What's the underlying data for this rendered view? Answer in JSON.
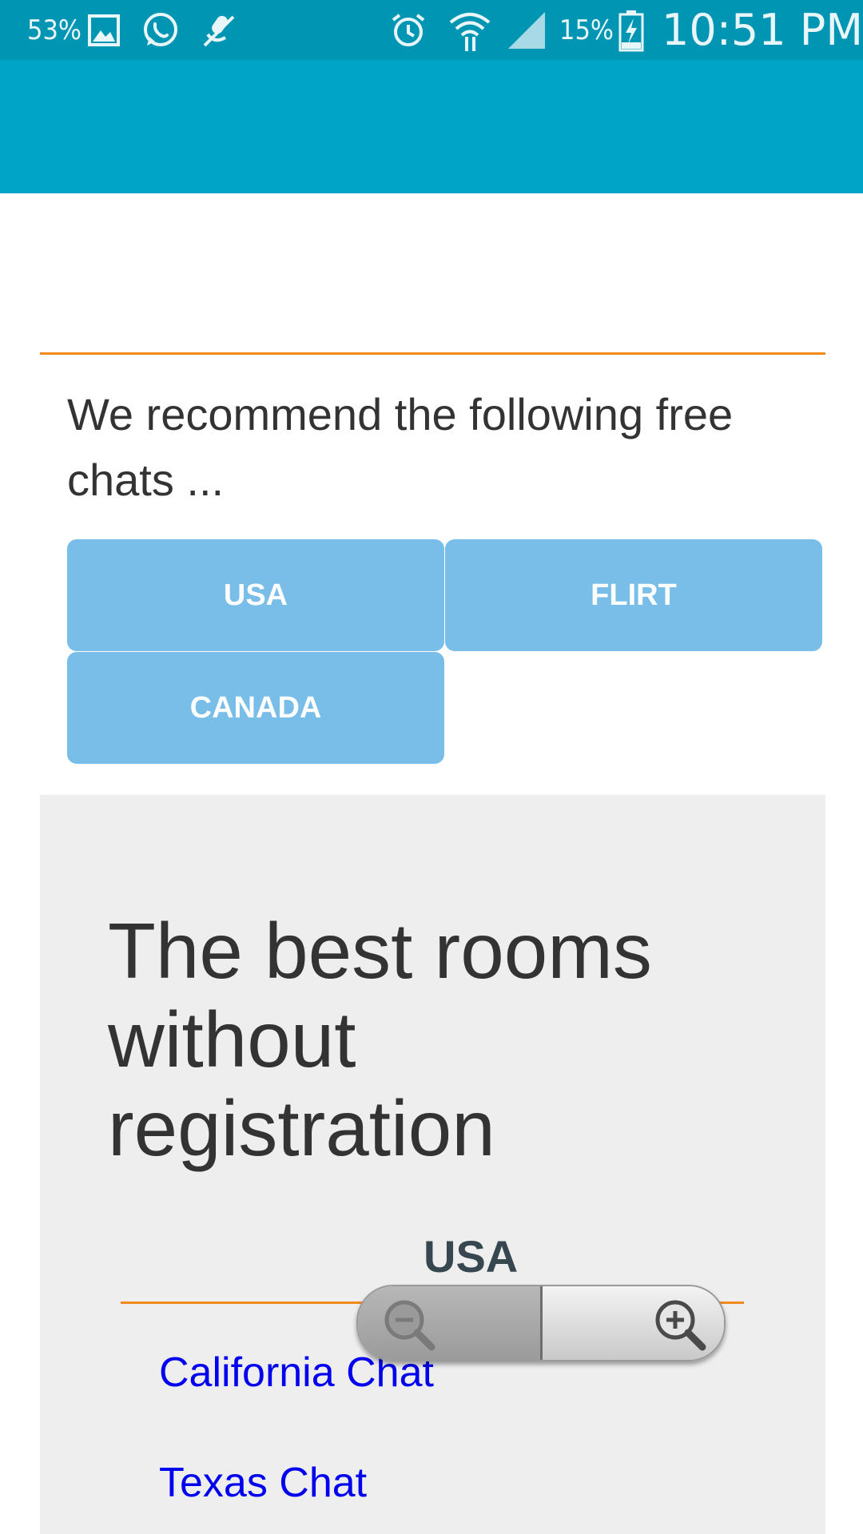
{
  "status_bar": {
    "battery_saver_percent": "53%",
    "battery_percent": "15%",
    "time": "10:51 PM",
    "icons": [
      "gallery-icon",
      "whatsapp-icon",
      "muted-mic-icon",
      "alarm-icon",
      "wifi-icon",
      "signal-icon",
      "battery-charging-icon"
    ]
  },
  "main": {
    "recommend_text": "We recommend the following free chats ...",
    "buttons": [
      {
        "label": "USA"
      },
      {
        "label": "FLIRT"
      },
      {
        "label": "CANADA"
      }
    ]
  },
  "rooms": {
    "headline": "The best rooms without registration",
    "section_title": "USA",
    "links": [
      {
        "label": "California Chat"
      },
      {
        "label": "Texas Chat"
      }
    ]
  },
  "zoom_control": {
    "icons": [
      "zoom-out-icon",
      "zoom-in-icon"
    ]
  },
  "colors": {
    "status_bar": "#0096b3",
    "toolbar": "#00a4c6",
    "accent_rule": "#f08a1c",
    "button": "#79bee8",
    "panel": "#eeeeee",
    "link": "#0000ee"
  }
}
